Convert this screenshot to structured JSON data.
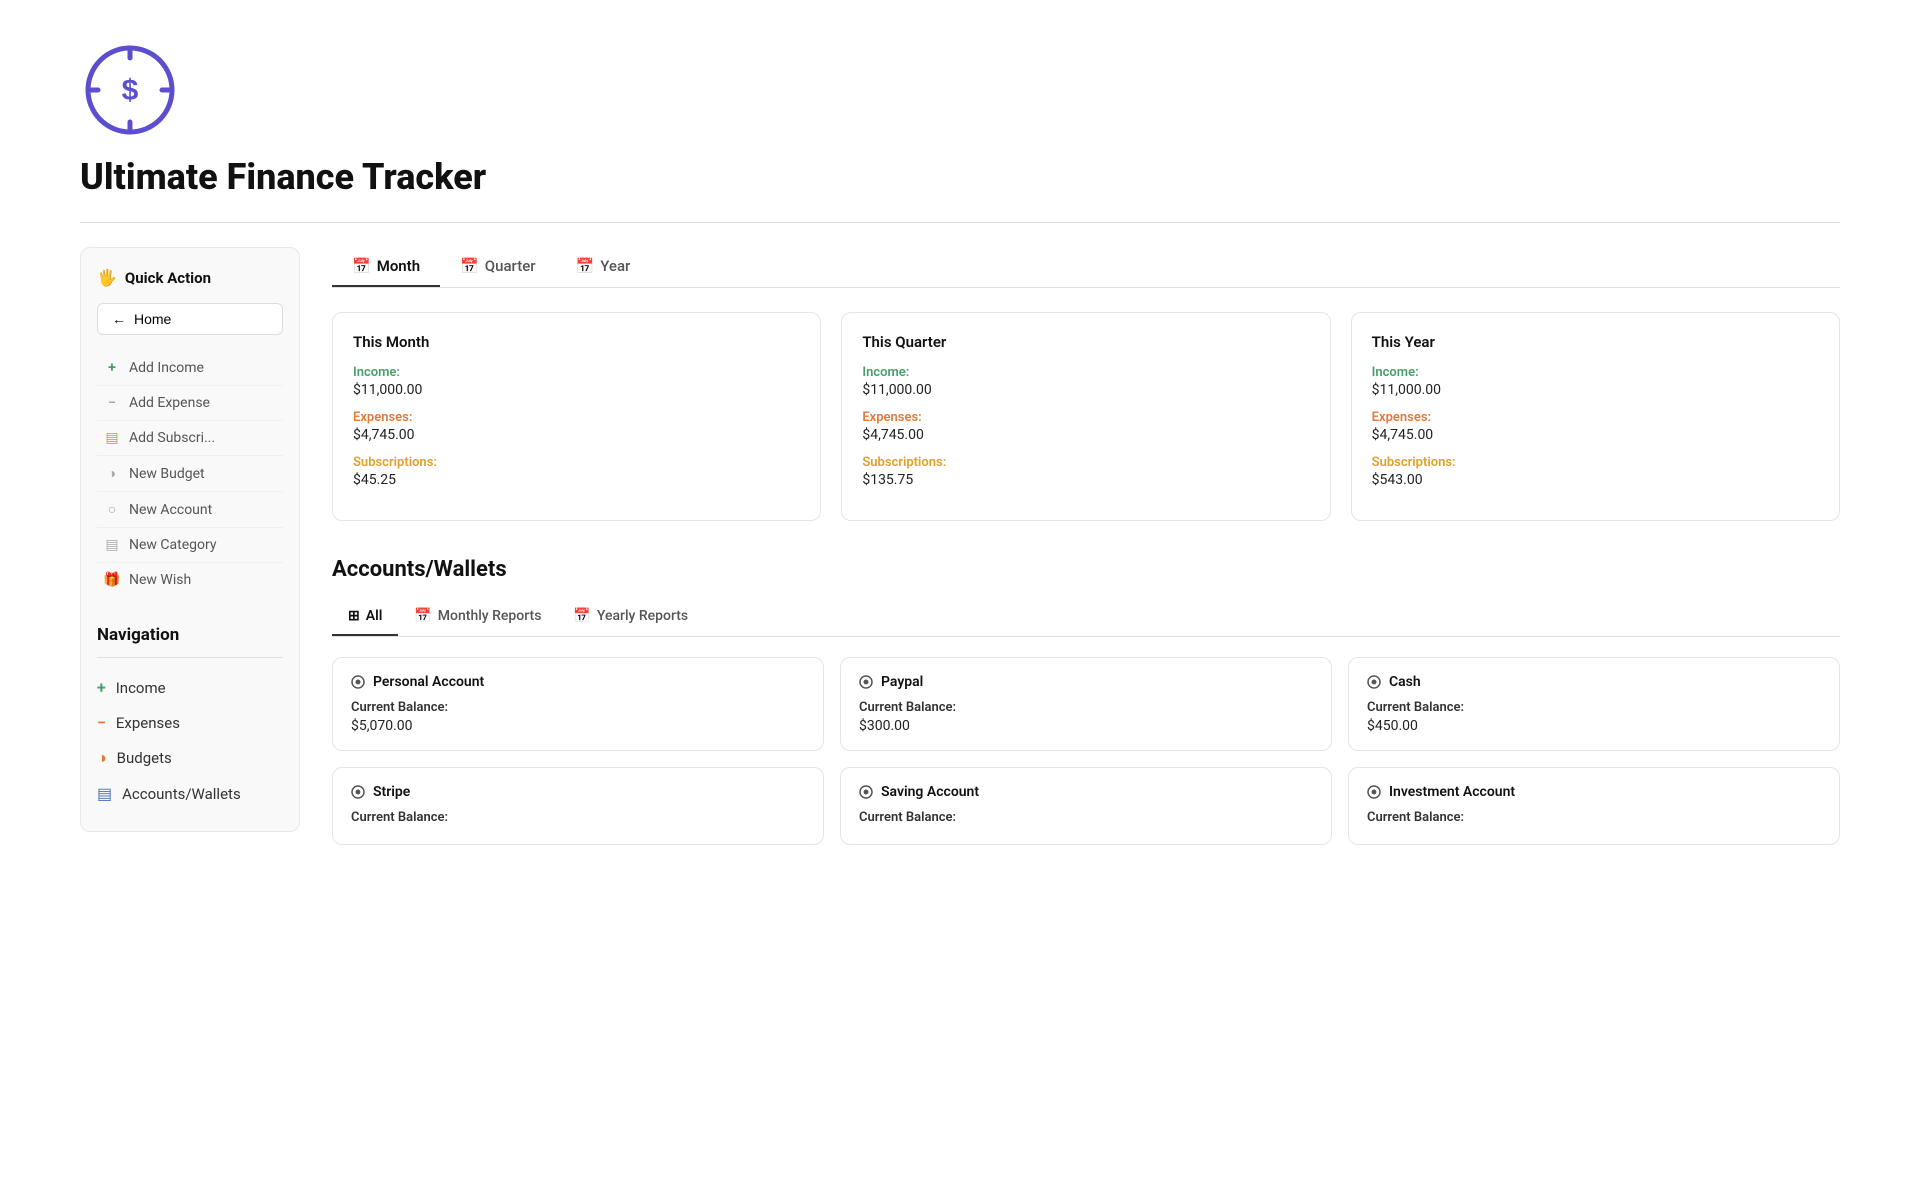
{
  "app": {
    "title": "Ultimate Finance Tracker"
  },
  "sidebar": {
    "quick_action_label": "Quick Action",
    "home_label": "Home",
    "actions": [
      {
        "id": "add-income",
        "label": "Add Income",
        "icon": "+"
      },
      {
        "id": "add-expense",
        "label": "Add Expense",
        "icon": "−"
      },
      {
        "id": "add-subscription",
        "label": "Add Subscri...",
        "icon": "▤"
      },
      {
        "id": "new-budget",
        "label": "New Budget",
        "icon": "◑"
      },
      {
        "id": "new-account",
        "label": "New Account",
        "icon": "○"
      },
      {
        "id": "new-category",
        "label": "New Category",
        "icon": "▤"
      },
      {
        "id": "new-wish",
        "label": "New Wish",
        "icon": "🎁"
      }
    ],
    "nav_title": "Navigation",
    "nav_items": [
      {
        "id": "income",
        "label": "Income",
        "icon": "+"
      },
      {
        "id": "expenses",
        "label": "Expenses",
        "icon": "−"
      },
      {
        "id": "budgets",
        "label": "Budgets",
        "icon": "◑"
      },
      {
        "id": "accounts-wallets",
        "label": "Accounts/Wallets",
        "icon": "▤"
      }
    ]
  },
  "period_tabs": [
    {
      "id": "month",
      "label": "Month",
      "icon": "📅",
      "active": true
    },
    {
      "id": "quarter",
      "label": "Quarter",
      "icon": "📅",
      "active": false
    },
    {
      "id": "year",
      "label": "Year",
      "icon": "📅",
      "active": false
    }
  ],
  "summary_cards": [
    {
      "id": "this-month",
      "title": "This Month",
      "income_label": "Income:",
      "income_value": "$11,000.00",
      "expense_label": "Expenses:",
      "expense_value": "$4,745.00",
      "subscription_label": "Subscriptions:",
      "subscription_value": "$45.25"
    },
    {
      "id": "this-quarter",
      "title": "This Quarter",
      "income_label": "Income:",
      "income_value": "$11,000.00",
      "expense_label": "Expenses:",
      "expense_value": "$4,745.00",
      "subscription_label": "Subscriptions:",
      "subscription_value": "$135.75"
    },
    {
      "id": "this-year",
      "title": "This Year",
      "income_label": "Income:",
      "income_value": "$11,000.00",
      "expense_label": "Expenses:",
      "expense_value": "$4,745.00",
      "subscription_label": "Subscriptions:",
      "subscription_value": "$543.00"
    }
  ],
  "accounts_section": {
    "title": "Accounts/Wallets",
    "tabs": [
      {
        "id": "all",
        "label": "All",
        "icon": "⊞",
        "active": true
      },
      {
        "id": "monthly-reports",
        "label": "Monthly Reports",
        "icon": "📅",
        "active": false
      },
      {
        "id": "yearly-reports",
        "label": "Yearly Reports",
        "icon": "📅",
        "active": false
      }
    ],
    "accounts": [
      {
        "id": "personal-account",
        "name": "Personal Account",
        "balance_label": "Current Balance:",
        "balance_value": "$5,070.00"
      },
      {
        "id": "paypal",
        "name": "Paypal",
        "balance_label": "Current Balance:",
        "balance_value": "$300.00"
      },
      {
        "id": "cash",
        "name": "Cash",
        "balance_label": "Current Balance:",
        "balance_value": "$450.00"
      },
      {
        "id": "stripe",
        "name": "Stripe",
        "balance_label": "Current Balance:",
        "balance_value": ""
      },
      {
        "id": "saving-account",
        "name": "Saving Account",
        "balance_label": "Current Balance:",
        "balance_value": ""
      },
      {
        "id": "investment-account",
        "name": "Investment Account",
        "balance_label": "Current Balance:",
        "balance_value": ""
      }
    ]
  },
  "colors": {
    "accent": "#5b4fcf",
    "income_green": "#4a9e6b",
    "expense_orange": "#e07b3a",
    "subscription_gold": "#e0a030"
  }
}
